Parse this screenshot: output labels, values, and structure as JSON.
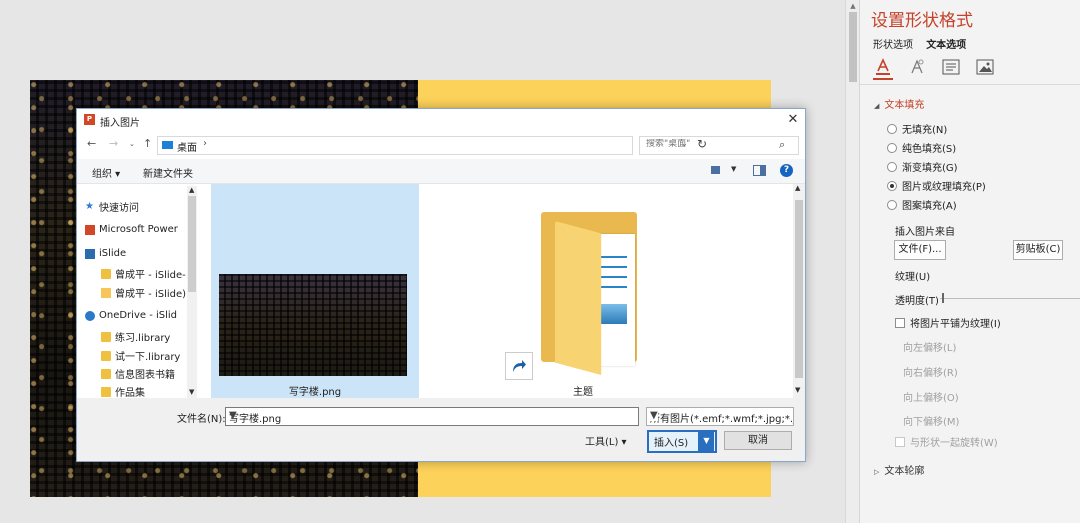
{
  "colors": {
    "accent": "#c4412a",
    "selected_tile": "#cce4f7",
    "slide_yellow": "#fcd25a"
  },
  "pane": {
    "title": "设置形状格式",
    "tabs": [
      "形状选项",
      "文本选项"
    ],
    "icons": [
      "text-fill-outline-icon",
      "text-effects-icon",
      "textbox-icon",
      "picture-icon"
    ],
    "section_fill": "文本填充",
    "fill_options": [
      {
        "label": "无填充(N)",
        "checked": false
      },
      {
        "label": "纯色填充(S)",
        "checked": false
      },
      {
        "label": "渐变填充(G)",
        "checked": false
      },
      {
        "label": "图片或纹理填充(P)",
        "checked": true
      },
      {
        "label": "图案填充(A)",
        "checked": false
      }
    ],
    "insert_from": "插入图片来自",
    "file_button": "文件(F)...",
    "clipboard_button": "剪贴板(C)",
    "texture": "纹理(U)",
    "transparency": "透明度(T)",
    "tile_checkbox": "将图片平铺为纹理(I)",
    "offsets": [
      "向左偏移(L)",
      "向右偏移(R)",
      "向上偏移(O)",
      "向下偏移(M)"
    ],
    "rotate_checkbox": "与形状一起旋转(W)",
    "section_line": "文本轮廓"
  },
  "dialog": {
    "title": "插入图片",
    "address": {
      "path": "桌面",
      "separator": "›"
    },
    "search_placeholder": "搜索\"桌面\"",
    "toolbar": {
      "organize": "组织 ▾",
      "new_folder": "新建文件夹"
    },
    "nav_items": [
      {
        "label": "快速访问",
        "icon": "star-icon"
      },
      {
        "label": "Microsoft Power",
        "icon": "powerpoint-icon"
      },
      {
        "label": "iSlide",
        "icon": "islide-icon"
      },
      {
        "label": "曾成平 - iSlide-",
        "icon": "library-icon"
      },
      {
        "label": "曾成平 - iSlide)",
        "icon": "folder-icon"
      },
      {
        "label": "OneDrive - iSlid",
        "icon": "onedrive-icon"
      },
      {
        "label": "练习.library",
        "icon": "library-icon"
      },
      {
        "label": "试一下.library",
        "icon": "library-icon"
      },
      {
        "label": "信息图表书籍",
        "icon": "library-icon"
      },
      {
        "label": "作品集",
        "icon": "library-icon"
      }
    ],
    "files": [
      {
        "name": "写字楼.png",
        "selected": true
      },
      {
        "name": "主题",
        "selected": false
      }
    ],
    "filename_label": "文件名(N):",
    "filename_value": "写字楼.png",
    "filetype": "所有图片(*.emf;*.wmf;*.jpg;*.jpeg",
    "tools": "工具(L)  ▾",
    "insert": "插入(S)",
    "cancel": "取消"
  }
}
